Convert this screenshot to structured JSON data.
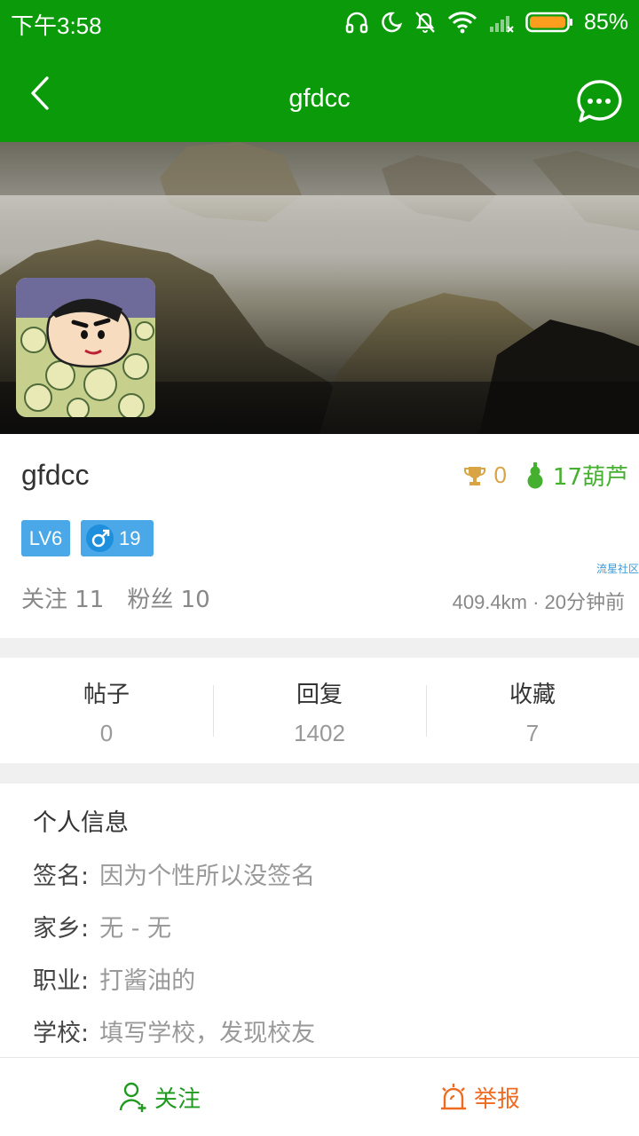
{
  "status_bar": {
    "time": "下午3:58",
    "battery": "85%",
    "icons": [
      "headphones-icon",
      "moon-icon",
      "mute-bell-icon",
      "wifi-icon",
      "signal-icon",
      "battery-icon"
    ]
  },
  "header": {
    "title": "gfdcc",
    "back_icon": "back-arrow-icon",
    "message_icon": "chat-bubble-icon"
  },
  "profile": {
    "username": "gfdcc",
    "trophies": "0",
    "gourds": "17葫芦",
    "level": "LV6",
    "age": "19",
    "watermark": "流星社区",
    "follow_label": "关注 11",
    "fans_label": "粉丝 10",
    "location": "409.4km · 20分钟前"
  },
  "counts": [
    {
      "label": "帖子",
      "value": "0"
    },
    {
      "label": "回复",
      "value": "1402"
    },
    {
      "label": "收藏",
      "value": "7"
    }
  ],
  "info": {
    "title": "个人信息",
    "rows": [
      {
        "key": "签名:",
        "value": "因为个性所以没签名"
      },
      {
        "key": "家乡:",
        "value": "无 - 无"
      },
      {
        "key": "职业:",
        "value": "打酱油的"
      },
      {
        "key": "学校:",
        "value": "填写学校，发现校友"
      }
    ]
  },
  "bottom": {
    "follow": "关注",
    "report": "举报"
  },
  "colors": {
    "primary_green": "#0a9a0a",
    "trophy": "#d8a444",
    "gourd": "#45b02f",
    "badge_blue": "#4aa8e8",
    "report_orange": "#ef6b22"
  }
}
